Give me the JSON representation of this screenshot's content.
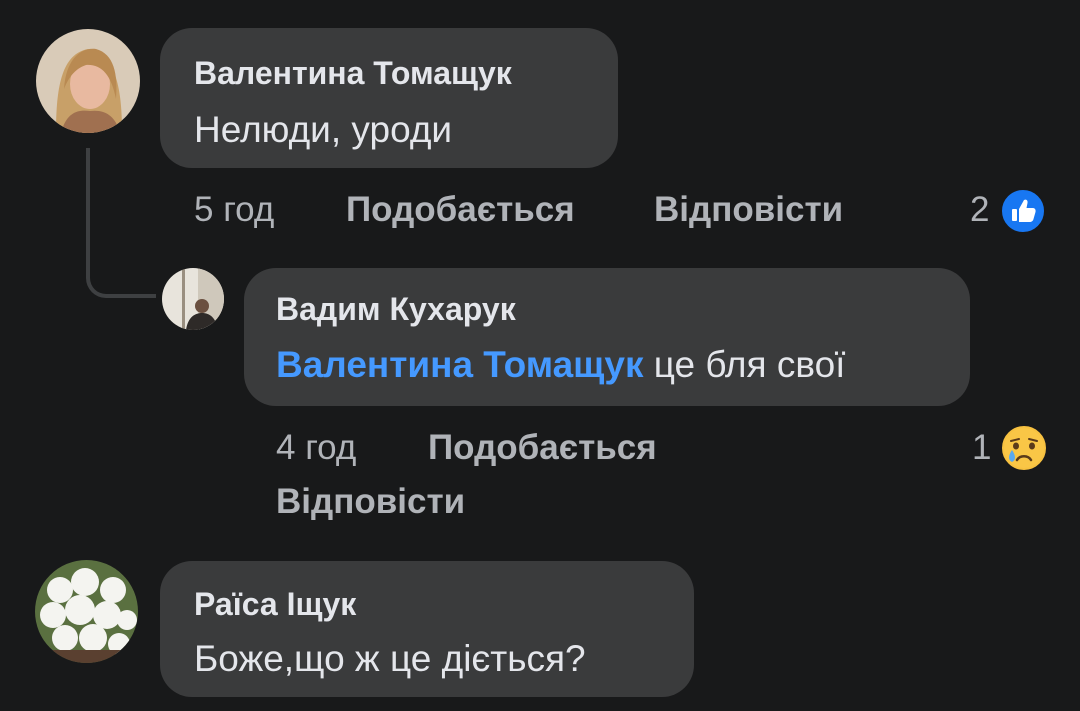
{
  "comments": [
    {
      "author": "Валентина Томащук",
      "text": "Нелюди, уроди",
      "time": "5 год",
      "like_label": "Подобається",
      "reply_label": "Відповісти",
      "reaction_count": "2",
      "reaction_icon": "like-icon"
    },
    {
      "author": "Вадим Кухарук",
      "mention": "Валентина Томащук",
      "text": "це бля свої",
      "time": "4 год",
      "like_label": "Подобається",
      "reply_label": "Відповісти",
      "reaction_count": "1",
      "reaction_icon": "sad-face-icon"
    },
    {
      "author": "Раїса Іщук",
      "text": "Боже,що ж це діється?"
    }
  ],
  "colors": {
    "background": "#18191a",
    "bubble": "#3a3b3c",
    "mention": "#4599ff",
    "like_blue": "#1877f2",
    "meta_text": "#b0b3b8"
  }
}
